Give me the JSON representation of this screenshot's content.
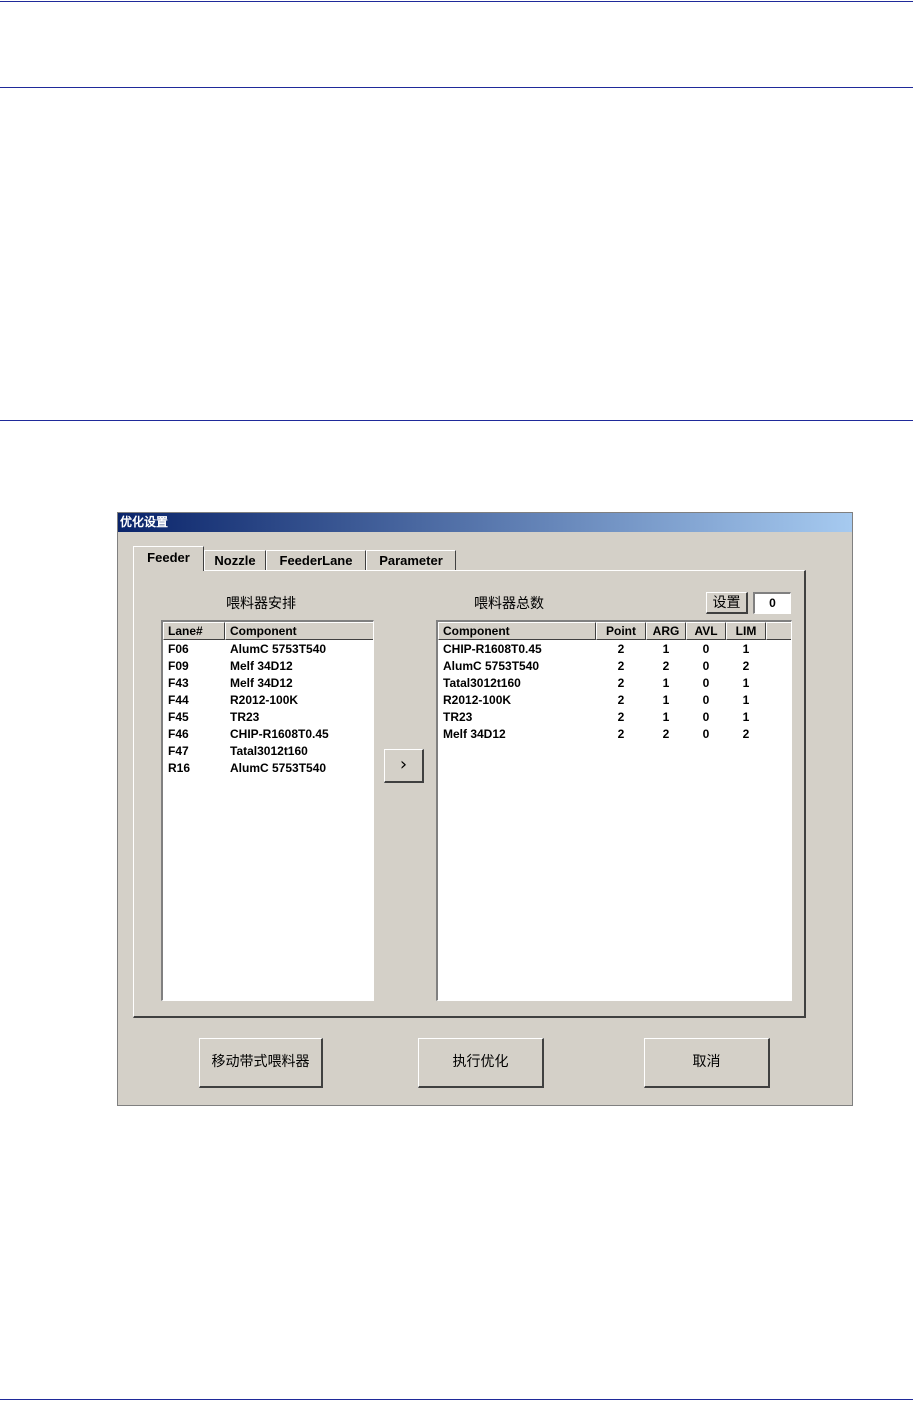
{
  "dialog": {
    "title": "优化设置",
    "tabs": [
      "Feeder",
      "Nozzle",
      "FeederLane",
      "Parameter"
    ],
    "active_tab": "Feeder",
    "left_caption": "喂料器安排",
    "right_caption": "喂料器总数",
    "set_button": "设置",
    "set_value": "0",
    "move_button": "›",
    "left_list": {
      "headers": [
        "Lane#",
        "Component"
      ],
      "rows": [
        [
          "F06",
          "AlumC 5753T540"
        ],
        [
          "F09",
          "Melf 34D12"
        ],
        [
          "F43",
          "Melf 34D12"
        ],
        [
          "F44",
          "R2012-100K"
        ],
        [
          "F45",
          "TR23"
        ],
        [
          "F46",
          "CHIP-R1608T0.45"
        ],
        [
          "F47",
          "Tatal3012t160"
        ],
        [
          "R16",
          "AlumC 5753T540"
        ]
      ]
    },
    "right_list": {
      "headers": [
        "Component",
        "Point",
        "ARG",
        "AVL",
        "LIM"
      ],
      "rows": [
        [
          "CHIP-R1608T0.45",
          "2",
          "1",
          "0",
          "1"
        ],
        [
          "AlumC 5753T540",
          "2",
          "2",
          "0",
          "2"
        ],
        [
          "Tatal3012t160",
          "2",
          "1",
          "0",
          "1"
        ],
        [
          "R2012-100K",
          "2",
          "1",
          "0",
          "1"
        ],
        [
          "TR23",
          "2",
          "1",
          "0",
          "1"
        ],
        [
          "Melf 34D12",
          "2",
          "2",
          "0",
          "2"
        ]
      ]
    },
    "buttons": {
      "mobile_feeder": "移动带式喂料器",
      "optimize": "执行优化",
      "cancel": "取消"
    }
  }
}
